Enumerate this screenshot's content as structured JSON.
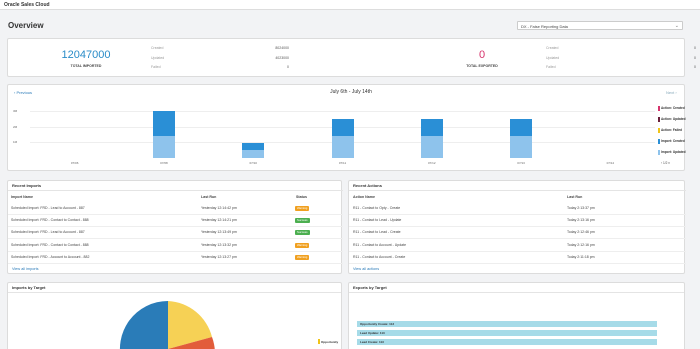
{
  "app": {
    "title": "Oracle Sales Cloud"
  },
  "header": {
    "title": "Overview",
    "dropdown_value": "DX - False Reporting Data",
    "dropdown_icon": "chevron-down-icon"
  },
  "imports_stats": {
    "total": "12047000",
    "label": "TOTAL IMPORTED",
    "rows": [
      {
        "label": "Created",
        "value": "8024000"
      },
      {
        "label": "Updated",
        "value": "4023000"
      },
      {
        "label": "Failed",
        "value": "0"
      }
    ]
  },
  "exports_stats": {
    "total": "0",
    "label": "TOTAL EXPORTED",
    "rows": [
      {
        "label": "Created",
        "value": "0"
      },
      {
        "label": "Updated",
        "value": "0"
      },
      {
        "label": "Failed",
        "value": "0"
      }
    ]
  },
  "colors": {
    "imports_total": "#2a8cc8",
    "exports_total": "#d6336c",
    "bar_created": "#2a8fd6",
    "bar_updated": "#8ec3ec",
    "action_created": "#d6336c",
    "action_updated": "#6b1f3a",
    "action_failed": "#f0c419",
    "import_created": "#2a8fd6",
    "import_updated": "#8ec3ec",
    "warning": "#f0a020",
    "success": "#4caf50"
  },
  "chart_nav": {
    "previous": "Previous",
    "next": "Next",
    "title": "July 6th - July 14th",
    "pager": "1/2"
  },
  "chart_data": {
    "type": "bar",
    "title": "July 6th - July 14th",
    "categories": [
      "07/06",
      "07/08",
      "07/10",
      "07/11",
      "07/12",
      "07/13",
      "07/14"
    ],
    "y_ticks": [
      "3M",
      "2M",
      "1M"
    ],
    "ylim": [
      0,
      3500000
    ],
    "stacked": true,
    "series": [
      {
        "name": "Import: Updated",
        "values": [
          0,
          1400000,
          500000,
          1400000,
          1400000,
          1400000,
          0
        ]
      },
      {
        "name": "Import: Created",
        "values": [
          0,
          1600000,
          450000,
          1100000,
          1100000,
          1100000,
          0
        ]
      }
    ],
    "legend": [
      "Action: Created",
      "Action: Updated",
      "Action: Failed",
      "Import: Created",
      "Import: Updated"
    ],
    "legend_position": "right",
    "grid": true
  },
  "recent_imports": {
    "title": "Recent Imports",
    "columns": [
      "Import Name",
      "Last Run",
      "Status"
    ],
    "rows": [
      {
        "name": "Scheduled Import: FRD - Lead to Account - 887",
        "last_run": "Yesterday 12:14:42 pm",
        "status": "Warning"
      },
      {
        "name": "Scheduled Import: FRD - Contact to Contact - 888",
        "last_run": "Yesterday 12:14:21 pm",
        "status": "Success"
      },
      {
        "name": "Scheduled Import: FRD - Lead to Account - 887",
        "last_run": "Yesterday 12:13:49 pm",
        "status": "Success"
      },
      {
        "name": "Scheduled Import: FRD - Contact to Contact - 888",
        "last_run": "Yesterday 12:13:32 pm",
        "status": "Warning"
      },
      {
        "name": "Scheduled Import: FRD - Account to Account - 882",
        "last_run": "Yesterday 12:13:27 pm",
        "status": "Warning"
      }
    ],
    "view_all": "View all imports"
  },
  "recent_actions": {
    "title": "Recent Actions",
    "columns": [
      "Action Name",
      "Last Run"
    ],
    "rows": [
      {
        "name": "R11 - Contact to Opty - Create",
        "last_run": "Today 2:13:37 pm"
      },
      {
        "name": "R11 - Contact to Lead - Update",
        "last_run": "Today 2:13:16 pm"
      },
      {
        "name": "R11 - Contact to Lead - Create",
        "last_run": "Today 2:12:46 pm"
      },
      {
        "name": "R11 - Contact to Account - Update",
        "last_run": "Today 2:12:16 pm"
      },
      {
        "name": "R11 - Contact to Account - Create",
        "last_run": "Today 2:11:18 pm"
      }
    ],
    "view_all": "View all actions"
  },
  "imports_by_target": {
    "title": "Imports by Target",
    "legend": [
      "Opportunity"
    ]
  },
  "exports_by_target": {
    "title": "Exports by Target",
    "bars": [
      {
        "label": "Opportunity Create: 113",
        "value": 113
      },
      {
        "label": "Lead Update: 113",
        "value": 113
      },
      {
        "label": "Lead Create: 113",
        "value": 113
      }
    ]
  }
}
